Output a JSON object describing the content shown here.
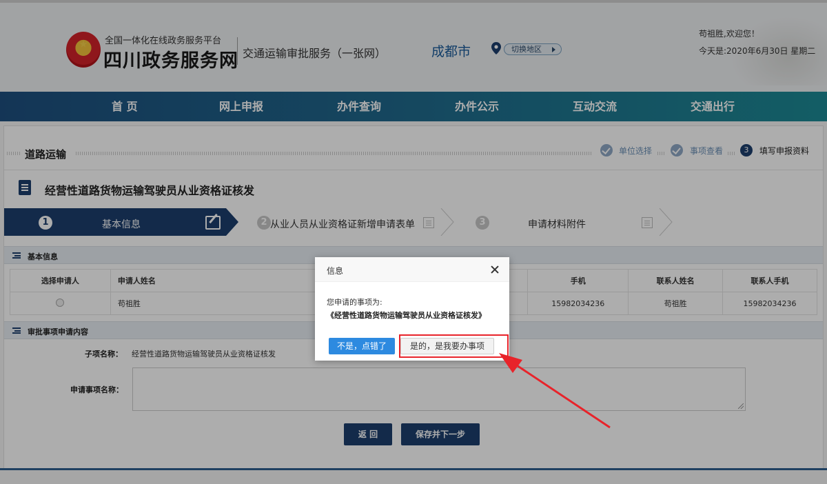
{
  "header": {
    "platform_sub": "全国一体化在线政务服务平台",
    "site_title": "四川政务服务网",
    "service_title": "交通运输审批服务（一张网）",
    "city": "成都市",
    "switch_region": "切换地区",
    "welcome": "苟祖胜,欢迎您！",
    "today": "今天是:2020年6月30日 星期二"
  },
  "nav": {
    "items": [
      "首 页",
      "网上申报",
      "办件查询",
      "办件公示",
      "互动交流",
      "交通出行"
    ]
  },
  "breadcrumb": {
    "section": "道路运输",
    "steps": [
      {
        "label": "单位选择",
        "state": "done"
      },
      {
        "label": "事项查看",
        "state": "done"
      },
      {
        "num": "3",
        "label": "填写申报资料",
        "state": "active"
      }
    ]
  },
  "item_title": "经营性道路货物运输驾驶员从业资格证核发",
  "wizard": {
    "steps": [
      {
        "num": "1",
        "label": "基本信息"
      },
      {
        "num": "2",
        "label": "从业人员从业资格证新增申请表单"
      },
      {
        "num": "3",
        "label": "申请材料附件"
      }
    ]
  },
  "basic_info": {
    "section_label": "基本信息",
    "columns": [
      "选择申请人",
      "申请人姓名",
      "手机",
      "联系人姓名",
      "联系人手机"
    ],
    "rows": [
      {
        "applicant_name": "苟祖胜",
        "phone": "15982034236",
        "contact_name": "苟祖胜",
        "contact_phone": "15982034236"
      }
    ]
  },
  "approval": {
    "section_label": "审批事项申请内容",
    "sub_item_label": "子项名称：",
    "sub_item_value": "经营性道路货物运输驾驶员从业资格证核发",
    "apply_name_label": "申请事项名称："
  },
  "buttons": {
    "back": "返 回",
    "save_next": "保存并下一步"
  },
  "dialog": {
    "title": "信息",
    "line1": "您申请的事项为:",
    "line2": "《经营性道路货物运输驾驶员从业资格证核发》",
    "btn_no": "不是，点错了",
    "btn_yes": "是的，是我要办事项"
  },
  "colors": {
    "primary": "#1c3f6e",
    "dialog_primary": "#2d8ae0",
    "annotation": "#e8232a"
  }
}
